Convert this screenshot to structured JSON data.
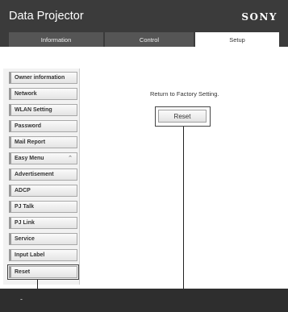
{
  "header": {
    "title": "Data Projector",
    "brand": "SONY"
  },
  "tabs": [
    {
      "label": "Information"
    },
    {
      "label": "Control"
    },
    {
      "label": "Setup"
    }
  ],
  "sidebar": {
    "items": [
      {
        "label": "Owner information"
      },
      {
        "label": "Network"
      },
      {
        "label": "WLAN Setting"
      },
      {
        "label": "Password"
      },
      {
        "label": "Mail Report"
      },
      {
        "label": "Easy Menu"
      },
      {
        "label": "Advertisement"
      },
      {
        "label": "ADCP"
      },
      {
        "label": "PJ Talk"
      },
      {
        "label": "PJ Link"
      },
      {
        "label": "Service"
      },
      {
        "label": "Input Label"
      },
      {
        "label": "Reset"
      }
    ]
  },
  "main": {
    "description": "Return to Factory Setting.",
    "reset_button": "Reset"
  },
  "footer": {
    "text": "-"
  },
  "colors": {
    "header": "#3b3b3b",
    "tab_inactive": "#555555",
    "footer": "#2e2e2e"
  }
}
